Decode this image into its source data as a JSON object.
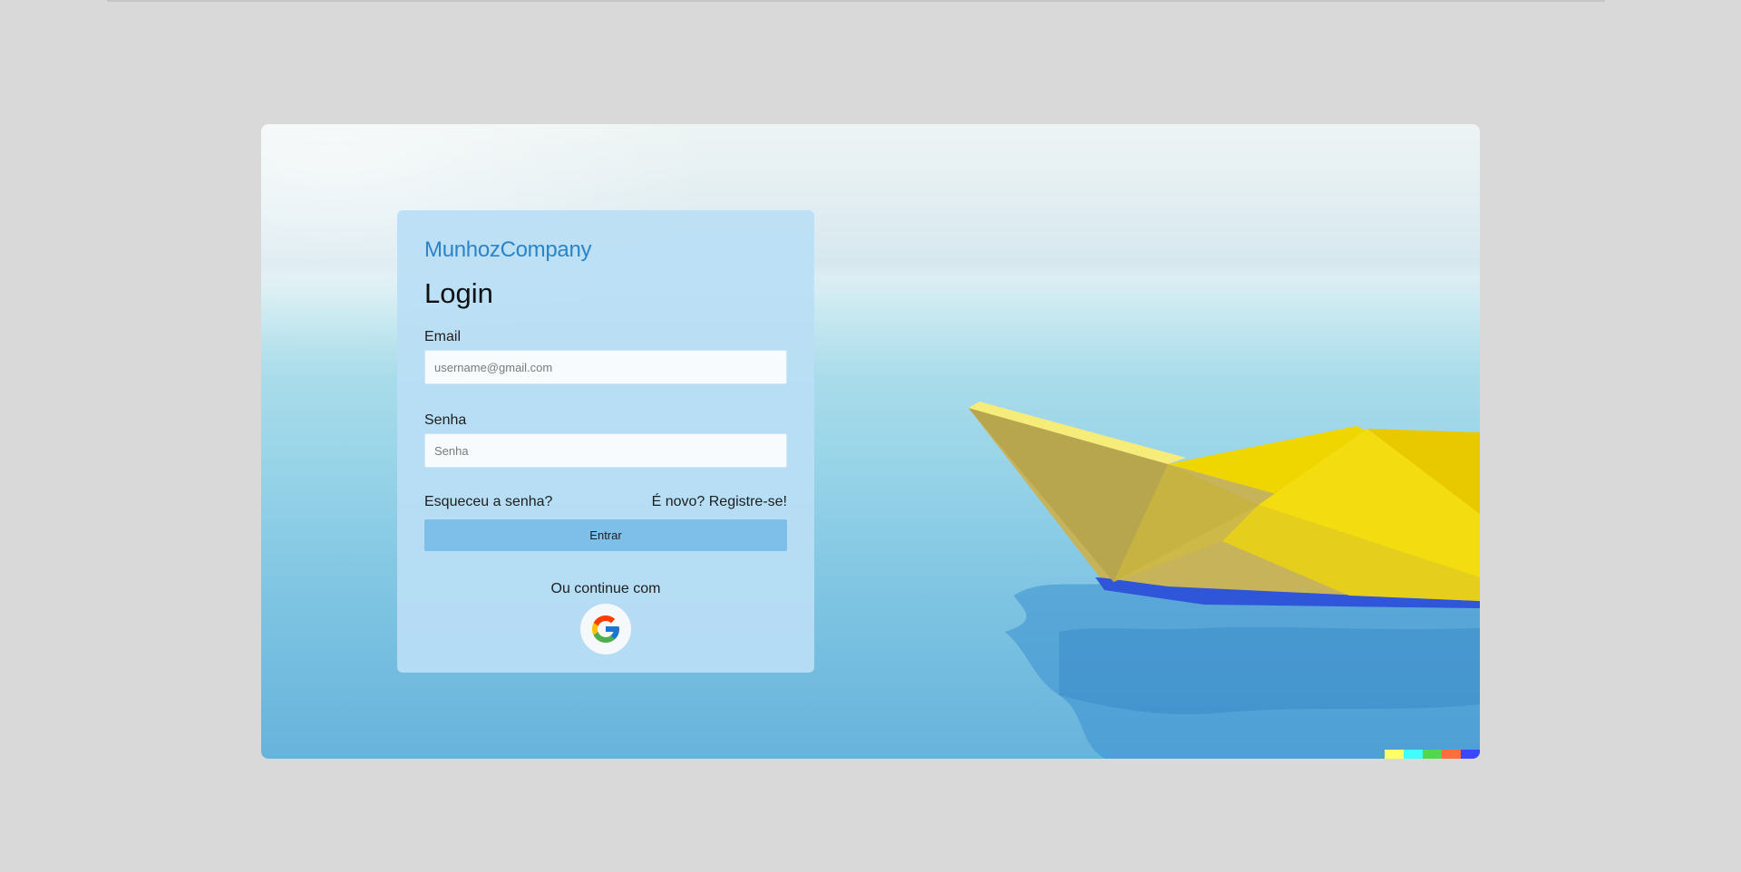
{
  "brand": {
    "name": "MunhozCompany",
    "color": "#2b84c7"
  },
  "login": {
    "title": "Login",
    "email_label": "Email",
    "email_placeholder": "username@gmail.com",
    "password_label": "Senha",
    "password_placeholder": "Senha",
    "forgot_password": "Esqueceu a senha?",
    "register": "É novo? Registre-se!",
    "submit_label": "Entrar",
    "alt_login_text": "Ou continue com",
    "alt_login_provider": "google-icon"
  },
  "colors": {
    "page_background": "#d9d9d9",
    "card_background": "#badef5",
    "button_background": "#7dbfe9",
    "boat": "#f2e000",
    "strip": [
      "#ffff66",
      "#42ffff",
      "#52d84f",
      "#ff6e3c",
      "#3c46ff"
    ]
  }
}
